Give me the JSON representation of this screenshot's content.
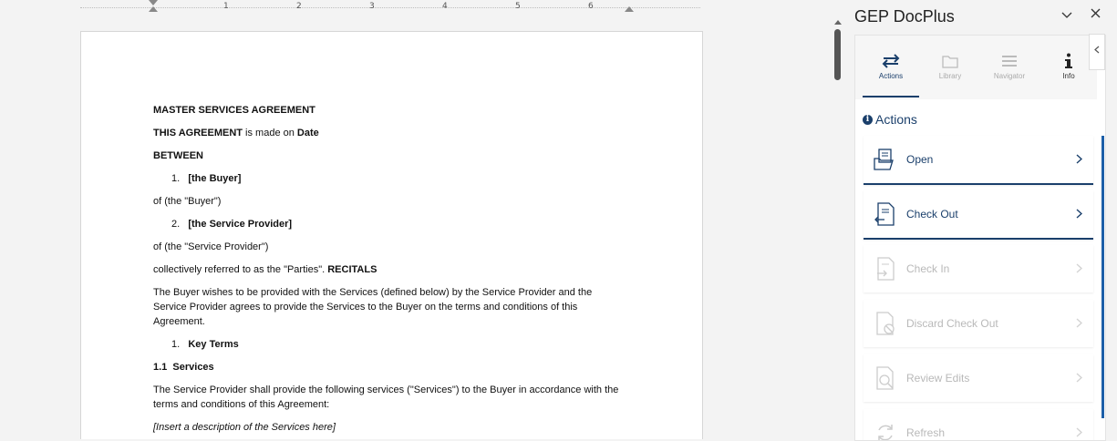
{
  "ruler": {
    "numbers": [
      "1",
      "2",
      "3",
      "4",
      "5",
      "6"
    ]
  },
  "document": {
    "title": "MASTER SERVICES AGREEMENT",
    "line2_bold": "THIS AGREEMENT",
    "line2_mid": " is made on ",
    "line2_date": "Date",
    "between": "BETWEEN",
    "party1_num": "1.",
    "party1": "[the Buyer]",
    "party1_of": "of (the \"Buyer\")",
    "party2_num": "2.",
    "party2": "[the Service Provider]",
    "party2_of": "of (the \"Service Provider\")",
    "collective": "collectively referred to as the \"Parties\". ",
    "recitals": "RECITALS",
    "recital_text": "The Buyer wishes to be provided with the Services (defined below) by the Service Provider and the Service Provider agrees to provide the Services to the Buyer on the terms and conditions of this Agreement.",
    "section1_num": "1.",
    "section1": "Key Terms",
    "sub11": "1.1  Services",
    "sub11_text": "The Service Provider shall provide the following services (\"Services\") to the Buyer in accordance with the terms and conditions of this Agreement:",
    "insert": "[Insert a description of the Services here]"
  },
  "pane": {
    "title": "GEP DocPlus",
    "tabs": [
      {
        "label": "Actions",
        "icon": "swap-arrows-icon"
      },
      {
        "label": "Library",
        "icon": "folder-icon"
      },
      {
        "label": "Navigator",
        "icon": "menu-lines-icon"
      },
      {
        "label": "Info",
        "icon": "info-icon"
      }
    ],
    "section_title": "Actions",
    "actions": [
      {
        "label": "Open",
        "enabled": true
      },
      {
        "label": "Check Out",
        "enabled": true
      },
      {
        "label": "Check In",
        "enabled": false
      },
      {
        "label": "Discard Check Out",
        "enabled": false
      },
      {
        "label": "Review Edits",
        "enabled": false
      },
      {
        "label": "Refresh",
        "enabled": false
      }
    ],
    "colors": {
      "accent": "#1a3f6b",
      "disabled": "#b9b9b9",
      "scroll": "#1d5fa8"
    }
  }
}
